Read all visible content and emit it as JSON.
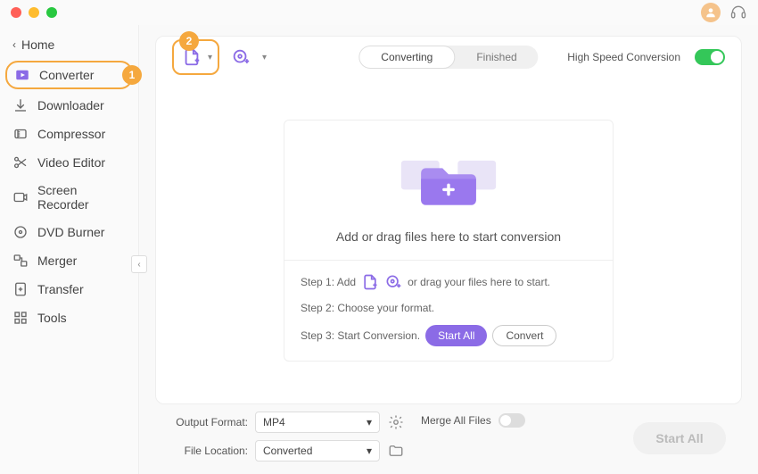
{
  "titlebar": {
    "avatar_initial": ""
  },
  "sidebar": {
    "home": "Home",
    "items": [
      {
        "label": "Converter"
      },
      {
        "label": "Downloader"
      },
      {
        "label": "Compressor"
      },
      {
        "label": "Video Editor"
      },
      {
        "label": "Screen Recorder"
      },
      {
        "label": "DVD Burner"
      },
      {
        "label": "Merger"
      },
      {
        "label": "Transfer"
      },
      {
        "label": "Tools"
      }
    ],
    "collapse_glyph": "‹"
  },
  "annotations": {
    "badge1": "1",
    "badge2": "2"
  },
  "toolbar": {
    "tabs": {
      "converting": "Converting",
      "finished": "Finished"
    },
    "high_speed_label": "High Speed Conversion"
  },
  "dropzone": {
    "main_text": "Add or drag files here to start conversion",
    "step1_prefix": "Step 1: Add",
    "step1_suffix": "or drag your files here to start.",
    "step2": "Step 2: Choose your format.",
    "step3_prefix": "Step 3: Start Conversion.",
    "start_all": "Start  All",
    "convert": "Convert"
  },
  "bottom": {
    "output_format_label": "Output Format:",
    "output_format_value": "MP4",
    "file_location_label": "File Location:",
    "file_location_value": "Converted",
    "merge_label": "Merge All Files",
    "start_all_btn": "Start All"
  }
}
